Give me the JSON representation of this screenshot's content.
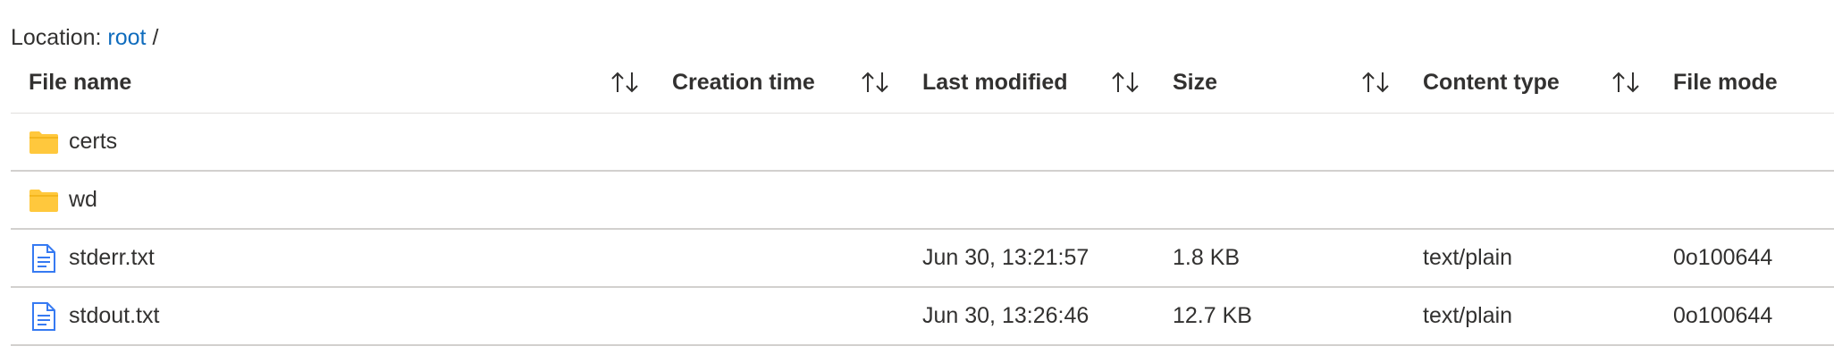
{
  "location": {
    "label": "Location:",
    "root_link": "root",
    "separator": "/"
  },
  "columns": [
    {
      "name": "file-name",
      "label": "File name"
    },
    {
      "name": "creation-time",
      "label": "Creation time"
    },
    {
      "name": "last-modified",
      "label": "Last modified"
    },
    {
      "name": "size",
      "label": "Size"
    },
    {
      "name": "content-type",
      "label": "Content type"
    },
    {
      "name": "file-mode",
      "label": "File mode"
    }
  ],
  "sort_icon": "sort-up-down-icon",
  "rows": [
    {
      "type": "folder",
      "icon": "folder-icon",
      "name": "certs",
      "creation_time": "",
      "last_modified": "",
      "size": "",
      "content_type": "",
      "file_mode": ""
    },
    {
      "type": "folder",
      "icon": "folder-icon",
      "name": "wd",
      "creation_time": "",
      "last_modified": "",
      "size": "",
      "content_type": "",
      "file_mode": ""
    },
    {
      "type": "file",
      "icon": "document-icon",
      "name": "stderr.txt",
      "creation_time": "",
      "last_modified": "Jun 30, 13:21:57",
      "size": "1.8 KB",
      "content_type": "text/plain",
      "file_mode": "0o100644"
    },
    {
      "type": "file",
      "icon": "document-icon",
      "name": "stdout.txt",
      "creation_time": "",
      "last_modified": "Jun 30, 13:26:46",
      "size": "12.7 KB",
      "content_type": "text/plain",
      "file_mode": "0o100644"
    }
  ],
  "colors": {
    "link": "#0f6cbd",
    "folder": "#ffc83d",
    "document": "#367af2",
    "text": "#323130"
  }
}
